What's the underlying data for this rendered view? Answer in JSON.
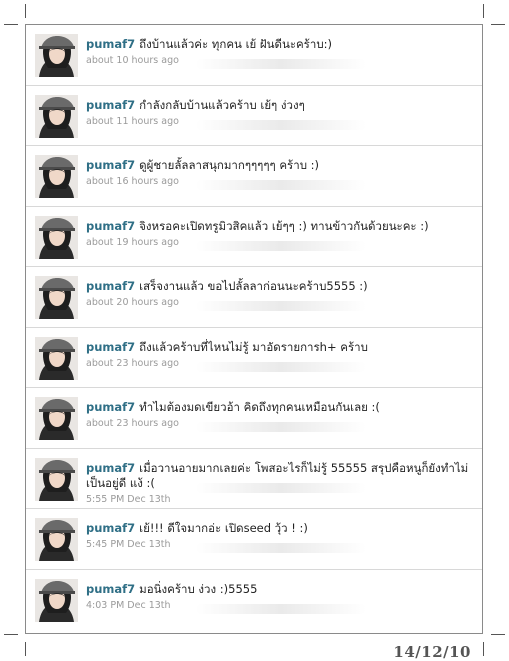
{
  "tweets": [
    {
      "user": "pumaf7",
      "text": "ถึงบ้านแล้วค่ะ ทุกคน เย้ ฝันดีนะคร้าบ:)",
      "time": "about 10 hours ago"
    },
    {
      "user": "pumaf7",
      "text": "กำลังกลับบ้านแล้วคร้าบ เย้ๆ ง่วงๆ",
      "time": "about 11 hours ago"
    },
    {
      "user": "pumaf7",
      "text": "ดูผู้ชายลั้ลลาสนุกมากๆๆๆๆๆ คร้าบ :)",
      "time": "about 16 hours ago"
    },
    {
      "user": "pumaf7",
      "text": "จิงหรอคะเปิดทรูมิวสิคแล้ว เย้ๆๆ :) ทานข้าวกันด้วยนะคะ :)",
      "time": "about 19 hours ago"
    },
    {
      "user": "pumaf7",
      "text": "เสร็จงานแล้ว ขอไปลั้ลลาก่อนนะคร้าบ5555 :)",
      "time": "about 20 hours ago"
    },
    {
      "user": "pumaf7",
      "text": "ถึงแล้วคร้าบที่ไหนไม่รู้ มาอัดรายการh+ คร้าบ",
      "time": "about 23 hours ago"
    },
    {
      "user": "pumaf7",
      "text": "ทำไมต้องมดเขียวอ้า คิดถึงทุกคนเหมือนกันเลย :(",
      "time": "about 23 hours ago"
    },
    {
      "user": "pumaf7",
      "text": "เมื่อวานอายมากเลยค่ะ โพสอะไรก็ไม่รู้ 55555 สรุปคือหนูก็ยังทำไม่เป็นอยู่ดี แง้ :(",
      "time": "5:55 PM Dec 13th"
    },
    {
      "user": "pumaf7",
      "text": "เย้!!! ดีใจมากอ่ะ เปิดseed วุ้ว ! :)",
      "time": "5:45 PM Dec 13th"
    },
    {
      "user": "pumaf7",
      "text": "มอนิ่งคร้าบ ง่วง :)5555",
      "time": "4:03 PM Dec 13th"
    }
  ],
  "stamp": "14/12/10",
  "colors": {
    "username": "#2f6f86",
    "meta": "#9a9a9a",
    "border": "#8a8a8a"
  }
}
